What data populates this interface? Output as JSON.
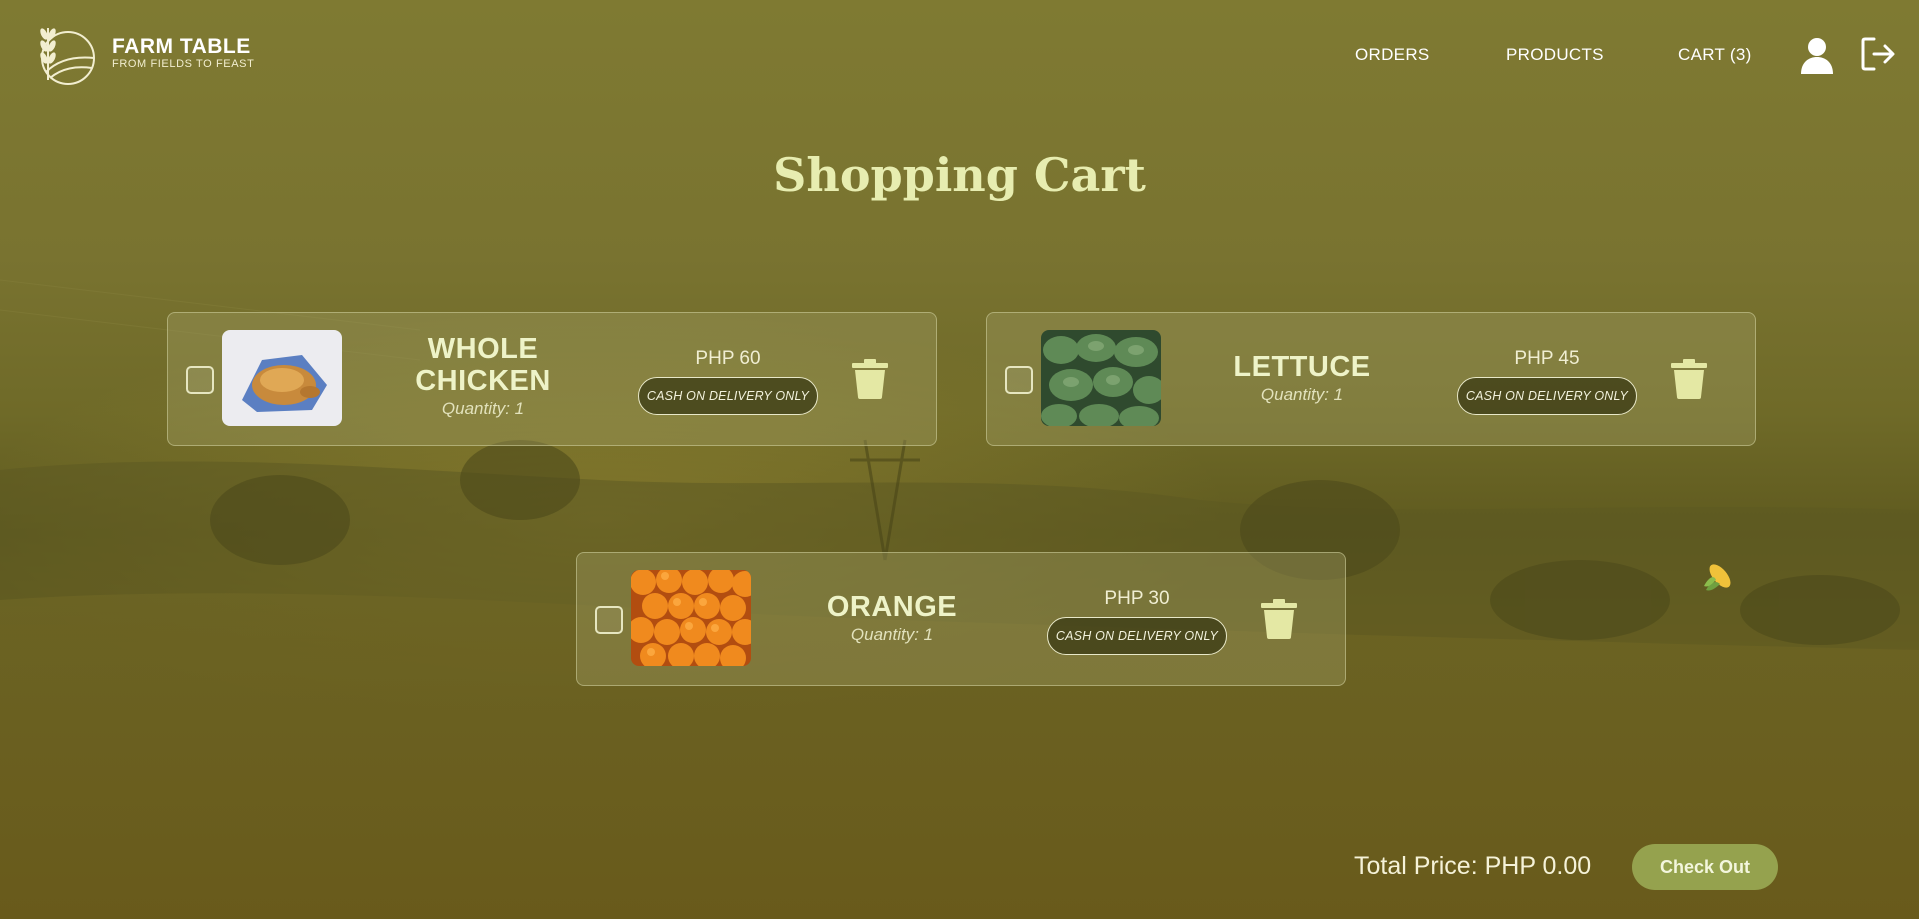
{
  "brand": {
    "name": "FARM TABLE",
    "tagline": "FROM FIELDS TO FEAST"
  },
  "nav": {
    "orders": "ORDERS",
    "products": "PRODUCTS",
    "cart": "CART (3)"
  },
  "icons": {
    "user": "user-icon",
    "logout": "logout-icon",
    "trash": "trash-icon",
    "corn": "corn-icon",
    "logo": "wheat-field-logo-icon"
  },
  "page": {
    "title": "Shopping Cart"
  },
  "cart": {
    "items": [
      {
        "name_line1": "WHOLE",
        "name_line2": "CHICKEN",
        "quantity": "Quantity: 1",
        "price": "PHP 60",
        "payment": "CASH ON DELIVERY ONLY",
        "image": "roast chicken"
      },
      {
        "name_line1": "LETTUCE",
        "name_line2": "",
        "quantity": "Quantity: 1",
        "price": "PHP 45",
        "payment": "CASH ON DELIVERY ONLY",
        "image": "lettuce"
      },
      {
        "name_line1": "ORANGE",
        "name_line2": "",
        "quantity": "Quantity: 1",
        "price": "PHP 30",
        "payment": "CASH ON DELIVERY ONLY",
        "image": "oranges"
      }
    ]
  },
  "footer": {
    "total": "Total Price: PHP 0.00",
    "checkout": "Check Out"
  },
  "colors": {
    "title": "#e7edb0",
    "checkout_bg": "#95a24e",
    "background": "#797330"
  }
}
